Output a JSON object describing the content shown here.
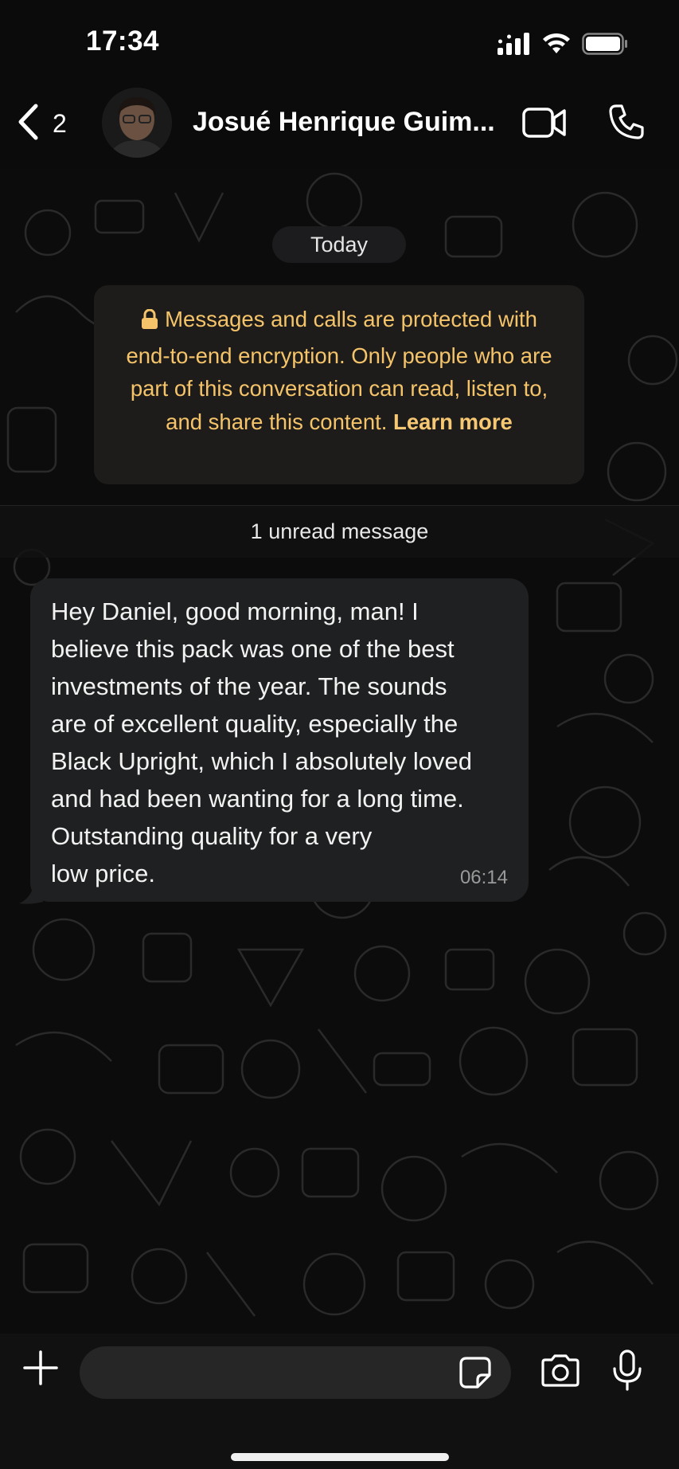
{
  "status_bar": {
    "time": "17:34",
    "icons": [
      "cellular-signal-icon",
      "wifi-icon",
      "battery-icon"
    ]
  },
  "header": {
    "back_count": "2",
    "contact_name": "Josué Henrique Guim...",
    "icons": [
      "back-chevron-icon",
      "video-camera-icon",
      "phone-icon"
    ]
  },
  "chat": {
    "date_label": "Today",
    "encryption_notice": {
      "text": "Messages and calls are protected with end-to-end encryption. Only people who are part of this conversation can read, listen to, and share this content.",
      "link": "Learn more"
    },
    "unread_label": "1 unread message",
    "messages": [
      {
        "direction": "incoming",
        "text": "Hey Daniel, good morning, man! I\nbelieve this pack was one of the best\ninvestments of the year. The sounds\nare of excellent quality, especially the\nBlack Upright, which I absolutely loved\nand had been wanting for a long time.\nOutstanding quality for a very\nlow price.",
        "time": "06:14"
      }
    ]
  },
  "input_bar": {
    "placeholder": "",
    "icons": [
      "plus-icon",
      "sticker-icon",
      "camera-icon",
      "microphone-icon"
    ]
  },
  "colors": {
    "background": "#0b0b0b",
    "bubble": "#1f2021",
    "notice_text": "#f5c46a",
    "notice_bg": "#1d1c1a"
  }
}
